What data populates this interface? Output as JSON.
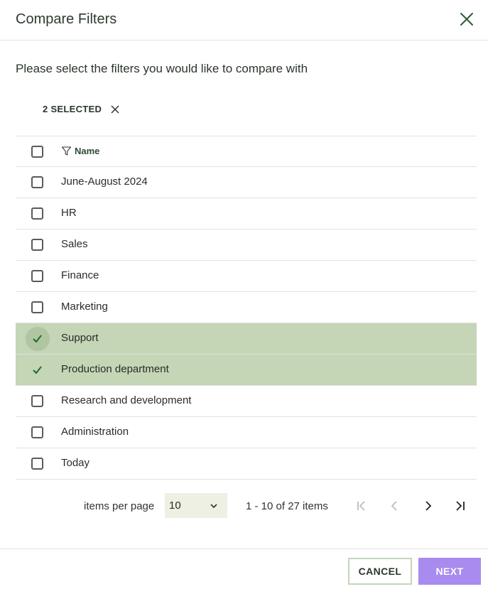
{
  "dialog": {
    "title": "Compare Filters",
    "prompt": "Please select the filters you would like to compare with"
  },
  "selection": {
    "label": "2 SELECTED"
  },
  "table": {
    "column_name": "Name",
    "rows": [
      {
        "name": "June-August 2024",
        "selected": false
      },
      {
        "name": "HR",
        "selected": false
      },
      {
        "name": "Sales",
        "selected": false
      },
      {
        "name": "Finance",
        "selected": false
      },
      {
        "name": "Marketing",
        "selected": false
      },
      {
        "name": "Support",
        "selected": true
      },
      {
        "name": "Production department",
        "selected": true
      },
      {
        "name": "Research and development",
        "selected": false
      },
      {
        "name": "Administration",
        "selected": false
      },
      {
        "name": "Today",
        "selected": false
      }
    ]
  },
  "pagination": {
    "items_per_page_label": "items per page",
    "items_per_page": "10",
    "range": "1 - 10 of 27 items"
  },
  "footer": {
    "cancel_label": "CANCEL",
    "next_label": "NEXT"
  },
  "colors": {
    "accent": "#a98bf0",
    "selected_row": "#c4d6b5",
    "check": "#1f6b2a"
  }
}
